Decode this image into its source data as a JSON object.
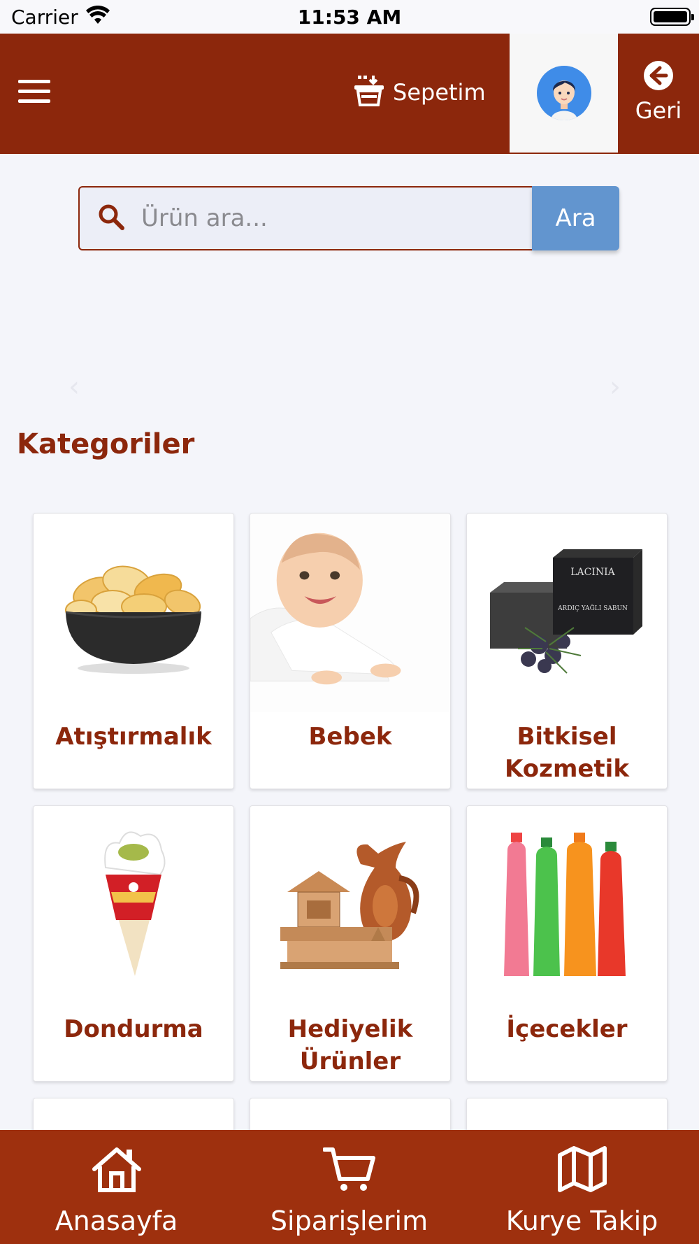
{
  "status_bar": {
    "carrier": "Carrier",
    "time": "11:53 AM"
  },
  "header": {
    "cart_label": "Sepetim",
    "back_label": "Geri"
  },
  "search": {
    "placeholder": "Ürün ara...",
    "button_label": "Ara"
  },
  "section_title": "Kategoriler",
  "categories": [
    {
      "name": "Atıştırmalık",
      "image": "chips-bowl"
    },
    {
      "name": "Bebek",
      "image": "baby-photo"
    },
    {
      "name": "Bitkisel Kozmetik",
      "image": "soap-box"
    },
    {
      "name": "Dondurma",
      "image": "ice-cream-cone"
    },
    {
      "name": "Hediyelik Ürünler",
      "image": "copper-jug-gift"
    },
    {
      "name": "İçecekler",
      "image": "soda-bottles"
    }
  ],
  "bottom_nav": [
    {
      "label": "Anasayfa",
      "icon": "home-icon"
    },
    {
      "label": "Siparişlerim",
      "icon": "cart-icon"
    },
    {
      "label": "Kurye Takip",
      "icon": "map-icon"
    }
  ],
  "colors": {
    "brand": "#8c270c",
    "button": "#6295cf",
    "nav": "#9e300e"
  }
}
